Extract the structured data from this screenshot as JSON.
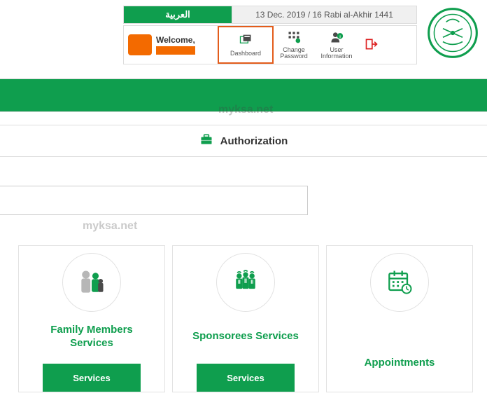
{
  "header": {
    "lang_label": "العربية",
    "date_text": "13 Dec. 2019 / 16 Rabi al-Akhir 1441",
    "welcome": "Welcome,",
    "nav": {
      "dashboard": "Dashboard",
      "change_password": "Change\nPassword",
      "user_information": "User\nInformation"
    }
  },
  "watermark": "myksa.net",
  "auth_label": "Authorization",
  "cards": {
    "family": {
      "title": "Family Members\nServices",
      "btn": "Services"
    },
    "sponsorees": {
      "title": "Sponsorees Services",
      "btn": "Services"
    },
    "appointments": {
      "title": "Appointments"
    }
  },
  "colors": {
    "green": "#0f9e4e",
    "orange": "#e35c1b"
  }
}
